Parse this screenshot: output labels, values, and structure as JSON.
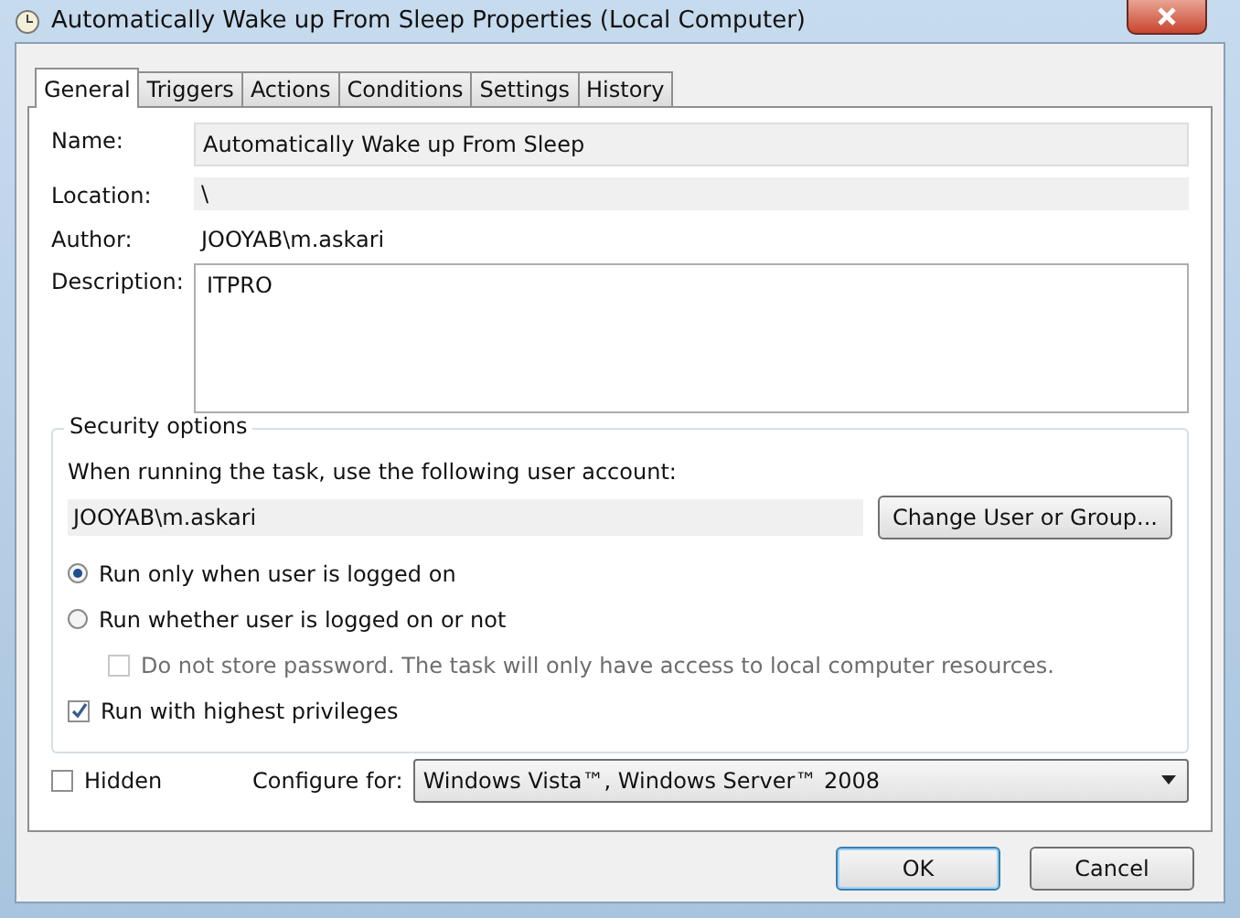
{
  "window": {
    "title": "Automatically Wake up From Sleep Properties (Local Computer)"
  },
  "tabs": [
    {
      "label": "General",
      "selected": true
    },
    {
      "label": "Triggers",
      "selected": false
    },
    {
      "label": "Actions",
      "selected": false
    },
    {
      "label": "Conditions",
      "selected": false
    },
    {
      "label": "Settings",
      "selected": false
    },
    {
      "label": "History",
      "selected": false
    }
  ],
  "fields": [
    {
      "label": "Name:",
      "value": "Automatically Wake up From Sleep",
      "kind": "input"
    },
    {
      "label": "Location:",
      "value": "\\",
      "kind": "input"
    },
    {
      "label": "Author:",
      "value": "JOOYAB\\m.askari",
      "kind": "plain"
    },
    {
      "label": "Description:",
      "value": "ITPRO",
      "kind": "area"
    }
  ],
  "security_options": {
    "title": "Security options",
    "account_prompt": "When running the task, use the following user account:",
    "account": "JOOYAB\\m.askari",
    "change_button": "Change User or Group...",
    "options": [
      {
        "label": "Run only when user is logged on",
        "kind": "radio",
        "selected": true,
        "disabled": false
      },
      {
        "label": "Run whether user is logged on or not",
        "kind": "radio",
        "selected": false,
        "disabled": false,
        "children": [
          {
            "label": "Do not store password.  The task will only have access to local computer resources.",
            "kind": "checkbox",
            "checked": false,
            "disabled": true
          }
        ]
      },
      {
        "label": "Run with highest privileges",
        "kind": "checkbox",
        "checked": true,
        "disabled": false
      }
    ]
  },
  "hidden": {
    "label": "Hidden",
    "checked": false
  },
  "configure_for": {
    "label": "Configure for:",
    "value": "Windows Vista™, Windows Server™ 2008"
  },
  "buttons": [
    "OK",
    "Cancel"
  ]
}
